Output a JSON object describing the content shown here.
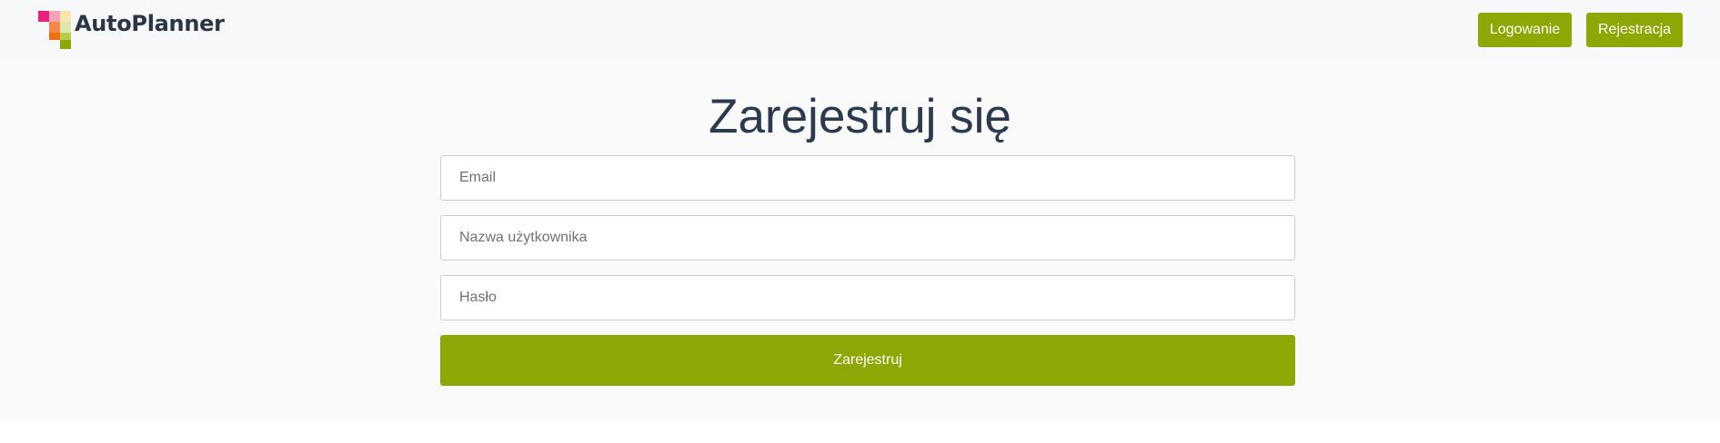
{
  "header": {
    "logo_text": "AutoPlanner",
    "login_label": "Logowanie",
    "register_label": "Rejestracja"
  },
  "form": {
    "title": "Zarejestruj się",
    "email": {
      "value": "",
      "placeholder": "Email"
    },
    "username": {
      "value": "",
      "placeholder": "Nazwa użytkownika"
    },
    "password": {
      "value": "",
      "placeholder": "Hasło"
    },
    "submit_label": "Zarejestruj"
  },
  "colors": {
    "accent": "#8da705",
    "title": "#2b3a4e",
    "navbar_bg": "#f7f8fa",
    "page_bg": "#fafafa"
  },
  "icons": {
    "logo_mark": "autoplanner-logo-icon"
  }
}
